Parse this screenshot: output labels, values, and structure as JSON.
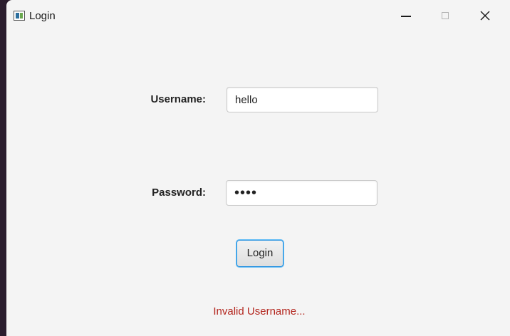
{
  "window": {
    "title": "Login",
    "controls": [
      "minimize-icon",
      "maximize-icon",
      "close-icon"
    ]
  },
  "form": {
    "username_label": "Username:",
    "username_value": "hello",
    "password_label": "Password:",
    "password_value": "1234",
    "login_label": "Login",
    "error_message": "Invalid Username..."
  },
  "colors": {
    "window_background": "#f4f4f4",
    "desktop_background": "#2b1d2e",
    "error_text": "#b3261e",
    "focus_border": "#1f8ee0"
  }
}
